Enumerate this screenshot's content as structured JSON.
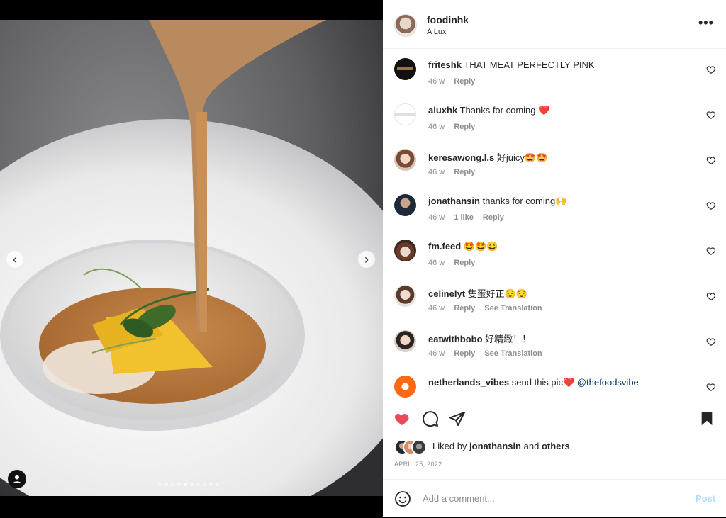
{
  "post": {
    "owner_username": "foodinhk",
    "owner_location": "A Lux",
    "liked_by_label": "Liked by",
    "liked_by_user": "jonathansin",
    "liked_by_and": "and",
    "liked_by_others": "others",
    "date": "APRIL 25, 2022",
    "media": {
      "current_slide": 5,
      "total_slides": 10
    }
  },
  "comments": [
    {
      "user": "friteshk",
      "text": "THAT MEAT PERFECTLY PINK",
      "age": "46 w",
      "reply": "Reply"
    },
    {
      "user": "aluxhk",
      "text": "Thanks for coming ❤️",
      "age": "46 w",
      "reply": "Reply"
    },
    {
      "user": "keresawong.l.s",
      "text": "好juicy🤩🤩",
      "age": "46 w",
      "reply": "Reply"
    },
    {
      "user": "jonathansin",
      "text": "thanks for coming🙌",
      "age": "46 w",
      "likes": "1 like",
      "reply": "Reply"
    },
    {
      "user": "fm.feed",
      "text": "🤩🤩😄",
      "age": "46 w",
      "reply": "Reply"
    },
    {
      "user": "celinelyt",
      "text": "隻蛋好正😌😌",
      "age": "46 w",
      "reply": "Reply",
      "translate": "See Translation"
    },
    {
      "user": "eatwithbobo",
      "text": "好精緻！！",
      "age": "46 w",
      "reply": "Reply",
      "translate": "See Translation"
    },
    {
      "user": "netherlands_vibes",
      "text": "send this pic❤️",
      "mention": "@thefoodsvibe"
    }
  ],
  "add_comment": {
    "placeholder": "Add a comment...",
    "post_label": "Post"
  },
  "icons": {
    "like": "heart-icon",
    "comment": "comment-icon",
    "share": "paper-plane-icon",
    "save": "bookmark-icon",
    "emoji": "emoji-icon",
    "more": "more-options-icon",
    "prev": "chevron-left-icon",
    "next": "chevron-right-icon",
    "tag": "user-tag-icon"
  },
  "colors": {
    "liked_heart": "#ed4956",
    "post_button": "#b2dffc",
    "mention": "#00376b",
    "muted": "#8e8e8e"
  }
}
